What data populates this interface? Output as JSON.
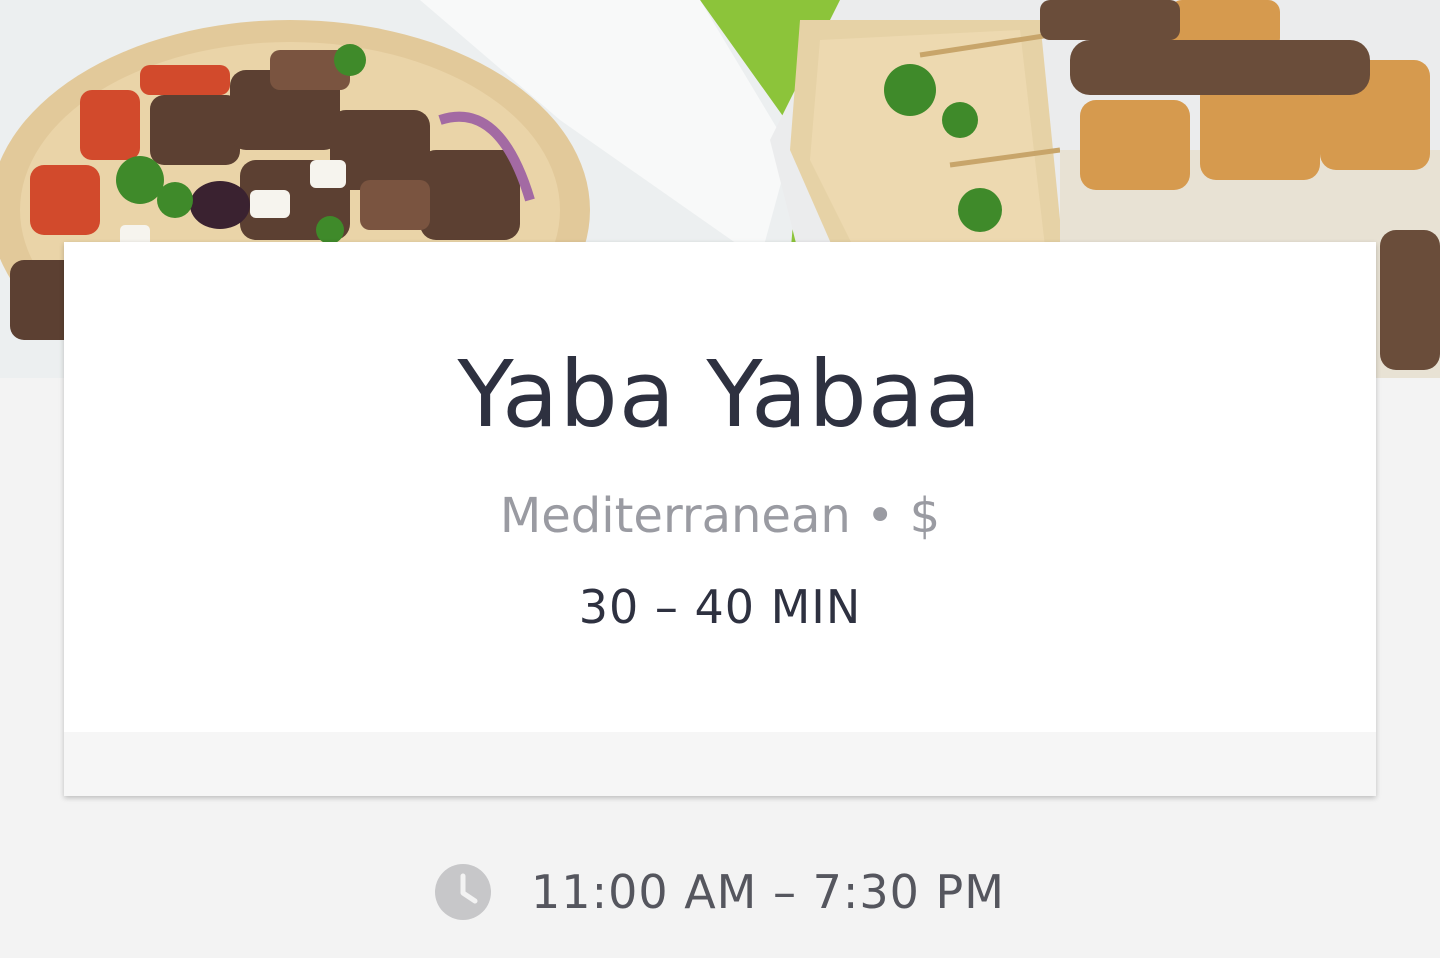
{
  "restaurant": {
    "name": "Yaba Yabaa",
    "cuisine_price": "Mediterranean • $",
    "eta": "30 – 40 MIN"
  },
  "hours": {
    "icon": "clock-icon",
    "text": "11:00 AM – 7:30 PM"
  },
  "colors": {
    "background": "#f3f3f3",
    "card": "#ffffff",
    "title": "#2e3140",
    "subtitle": "#9a9ba2",
    "hours_text": "#55565e",
    "icon": "#c7c7c9"
  }
}
